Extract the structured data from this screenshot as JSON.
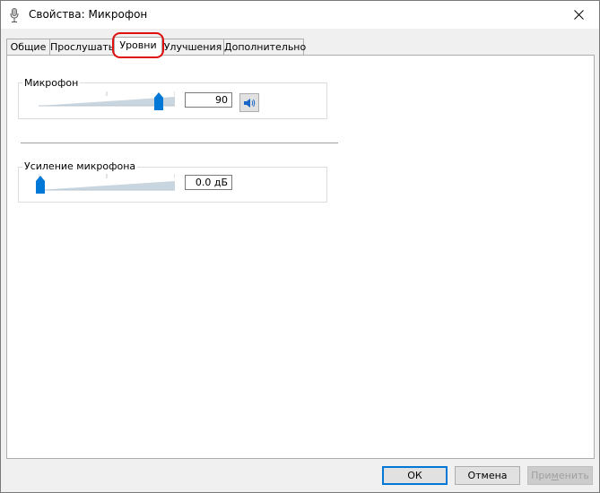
{
  "window": {
    "title": "Свойства: Микрофон",
    "icon": "microphone-icon"
  },
  "tabs": [
    {
      "label": "Общие",
      "active": false
    },
    {
      "label": "Прослушать",
      "active": false
    },
    {
      "label": "Уровни",
      "active": true
    },
    {
      "label": "Улучшения",
      "active": false
    },
    {
      "label": "Дополнительно",
      "active": false
    }
  ],
  "microphone": {
    "label": "Микрофон",
    "value": "90",
    "level_percent": 90,
    "mute_icon": "speaker-icon"
  },
  "boost": {
    "label": "Усиление микрофона",
    "value": "0.0 дБ",
    "level_percent": 0
  },
  "buttons": {
    "ok": "ОК",
    "cancel": "Отмена",
    "apply_prefix": "При",
    "apply_underlined": "м",
    "apply_suffix": "енить"
  },
  "colors": {
    "accent": "#0078d7",
    "highlight": "#e01010",
    "slider_track": "#c9d6df"
  }
}
